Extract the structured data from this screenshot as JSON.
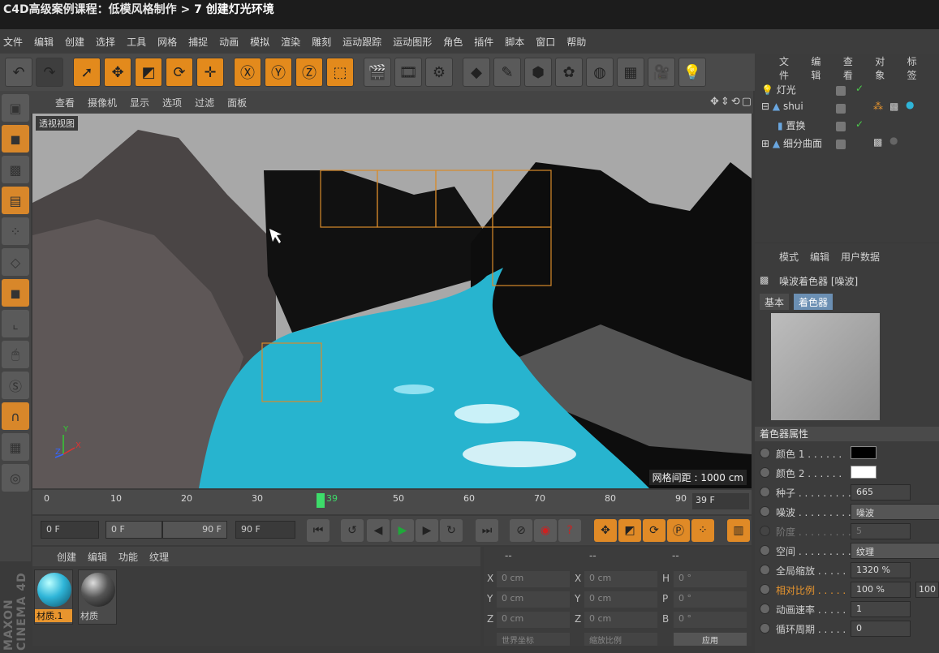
{
  "window": {
    "title_prefix": "C4D高级案例课程：低模风格制作 > ",
    "title_highlight": "7 创建灯光环境"
  },
  "menu": [
    "文件",
    "编辑",
    "创建",
    "选择",
    "工具",
    "网格",
    "捕捉",
    "动画",
    "模拟",
    "渲染",
    "雕刻",
    "运动跟踪",
    "运动图形",
    "角色",
    "插件",
    "脚本",
    "窗口",
    "帮助"
  ],
  "viewport": {
    "menu": [
      "查看",
      "摄像机",
      "显示",
      "选项",
      "过滤",
      "面板"
    ],
    "label": "透视视图",
    "grid_spacing": "网格间距 : 1000 cm",
    "axis_y": "Y",
    "axis_z": "Z",
    "axis_x": "X"
  },
  "timeline": {
    "ticks": [
      "0",
      "10",
      "20",
      "30",
      "39",
      "50",
      "60",
      "70",
      "80",
      "90"
    ],
    "current": "39",
    "frame_field": "39 F"
  },
  "transport": {
    "start": "0 F",
    "range_start": "0 F",
    "range_end": "90 F",
    "end": "90 F"
  },
  "material_manager": {
    "menu": [
      "创建",
      "编辑",
      "功能",
      "纹理"
    ],
    "materials": [
      {
        "name": "材质.1",
        "color": "#2fb5d8"
      },
      {
        "name": "材质",
        "color": "#555555"
      }
    ]
  },
  "coordinates": {
    "header": [
      "--",
      "--",
      "--"
    ],
    "rows": [
      {
        "a": "X",
        "av": "0 cm",
        "b": "X",
        "bv": "0 cm",
        "c": "H",
        "cv": "0 °"
      },
      {
        "a": "Y",
        "av": "0 cm",
        "b": "Y",
        "bv": "0 cm",
        "c": "P",
        "cv": "0 °"
      },
      {
        "a": "Z",
        "av": "0 cm",
        "b": "Z",
        "bv": "0 cm",
        "c": "B",
        "cv": "0 °"
      }
    ],
    "mode1": "世界坐标",
    "mode2": "缩放比例",
    "apply": "应用"
  },
  "object_manager": {
    "menu": [
      "文件",
      "编辑",
      "查看",
      "对象",
      "标签"
    ],
    "objects": [
      "灯光",
      "shui",
      "置换",
      "细分曲面"
    ]
  },
  "attribute_manager": {
    "menu": [
      "模式",
      "编辑",
      "用户数据"
    ],
    "shader_title": "噪波着色器 [噪波]",
    "tabs": [
      "基本",
      "着色器"
    ],
    "section": "着色器属性",
    "props": [
      {
        "label": "颜色 1 . . . . . .",
        "type": "color",
        "value": "#000000"
      },
      {
        "label": "颜色 2 . . . . . .",
        "type": "color",
        "value": "#ffffff"
      },
      {
        "label": "种子 . . . . . . . . .",
        "type": "num",
        "value": "665"
      },
      {
        "label": "噪波 . . . . . . . . .",
        "type": "select",
        "value": "噪波"
      },
      {
        "label": "阶度 . . . . . . . . .",
        "type": "dis",
        "value": "5"
      },
      {
        "label": "空间 . . . . . . . . .",
        "type": "select",
        "value": "纹理"
      },
      {
        "label": "全局缩放 . . . . .",
        "type": "num",
        "value": "1320 %"
      },
      {
        "label": "相对比例 . . . . .",
        "type": "num",
        "value": "100 %",
        "extra": "100",
        "highlight": true
      },
      {
        "label": "动画速率 . . . . .",
        "type": "num",
        "value": "1"
      },
      {
        "label": "循环周期 . . . . .",
        "type": "num",
        "value": "0"
      }
    ]
  },
  "branding": "MAXON CINEMA 4D"
}
